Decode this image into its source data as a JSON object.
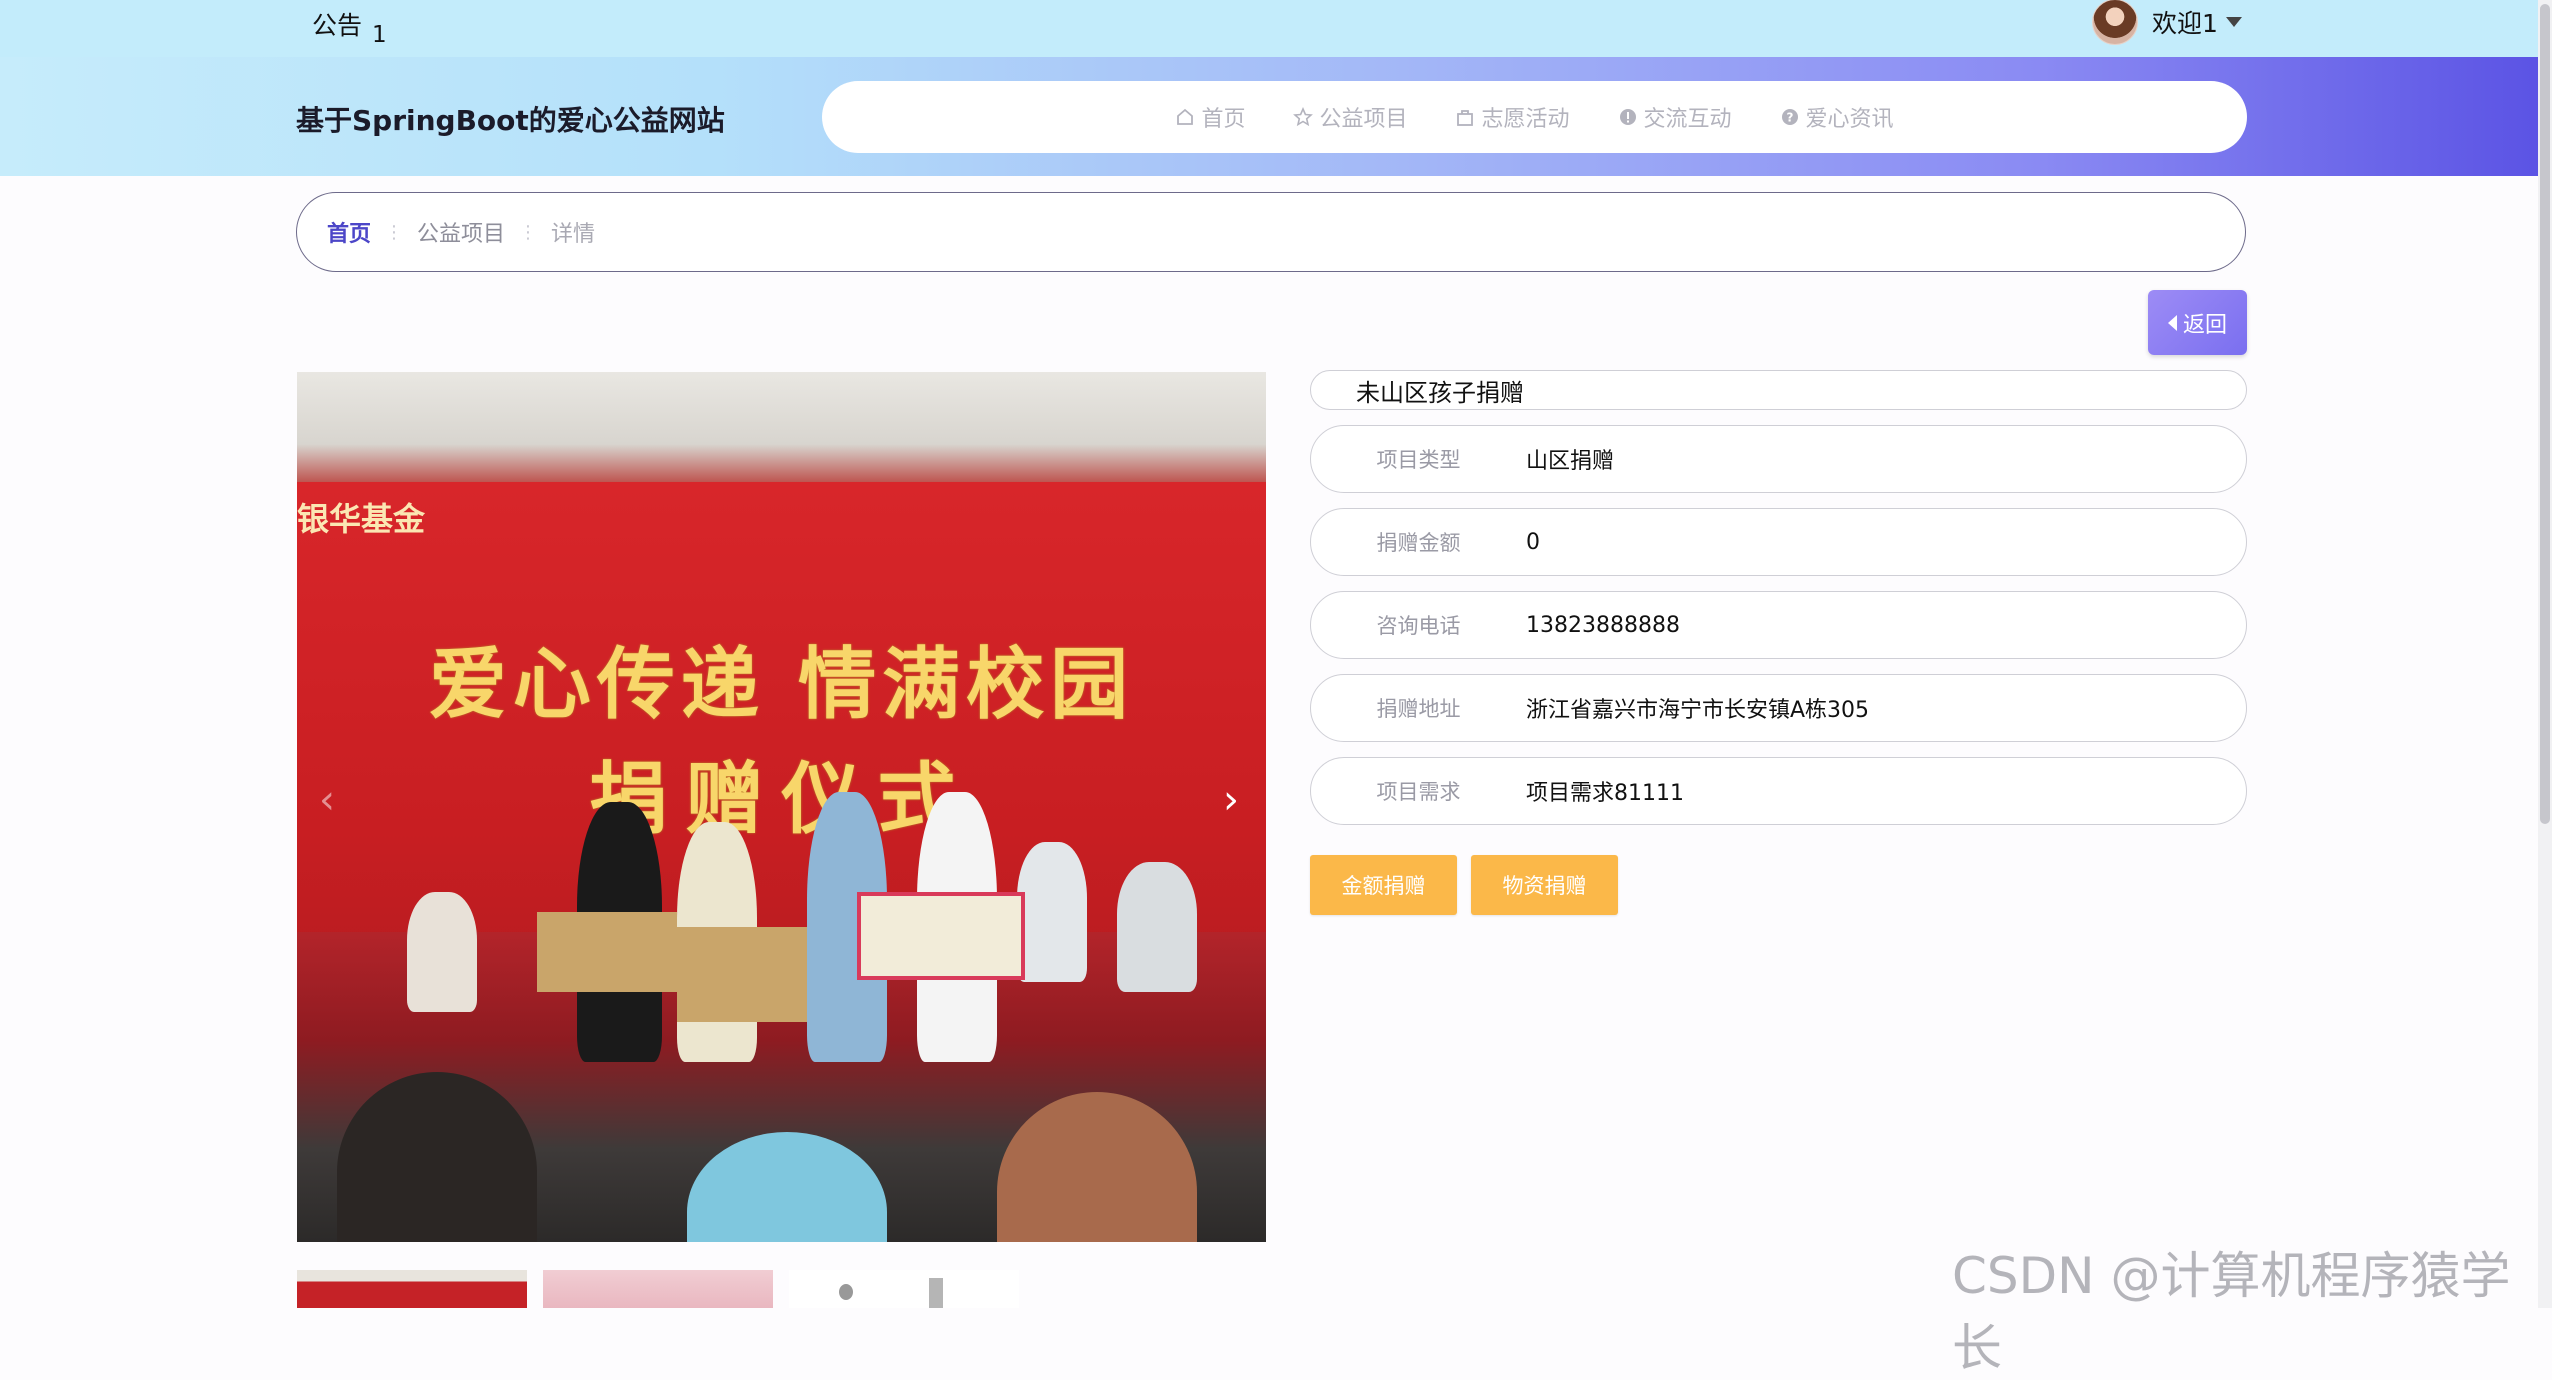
{
  "topbar": {
    "notice_label": "公告",
    "notice_count": "1",
    "welcome_text": "欢迎1"
  },
  "header": {
    "site_title": "基于SpringBoot的爱心公益网站",
    "nav": [
      {
        "label": "首页",
        "icon": "home-icon"
      },
      {
        "label": "公益项目",
        "icon": "star-icon"
      },
      {
        "label": "志愿活动",
        "icon": "bag-icon"
      },
      {
        "label": "交流互动",
        "icon": "info-circle-icon"
      },
      {
        "label": "爱心资讯",
        "icon": "question-circle-icon"
      }
    ]
  },
  "breadcrumb": {
    "home": "首页",
    "section": "公益项目",
    "current": "详情"
  },
  "back_button": "返回",
  "carousel": {
    "banner_sponsor": "银华基金",
    "banner_line1": "爱心传递  情满校园",
    "banner_line2": "捐赠仪式",
    "thumbnail_count": 3
  },
  "project": {
    "title": "未山区孩子捐赠",
    "fields": [
      {
        "label": "项目类型",
        "value": "山区捐赠"
      },
      {
        "label": "捐赠金额",
        "value": "0"
      },
      {
        "label": "咨询电话",
        "value": "13823888888"
      },
      {
        "label": "捐赠地址",
        "value": "浙江省嘉兴市海宁市长安镇A栋305"
      },
      {
        "label": "项目需求",
        "value": "项目需求81111"
      }
    ],
    "buttons": {
      "money": "金额捐赠",
      "goods": "物资捐赠"
    }
  },
  "watermark": "CSDN @计算机程序猿学长",
  "colors": {
    "accent": "#4c46c8",
    "donate_button": "#fbb849",
    "back_button": "#8a7df2"
  }
}
